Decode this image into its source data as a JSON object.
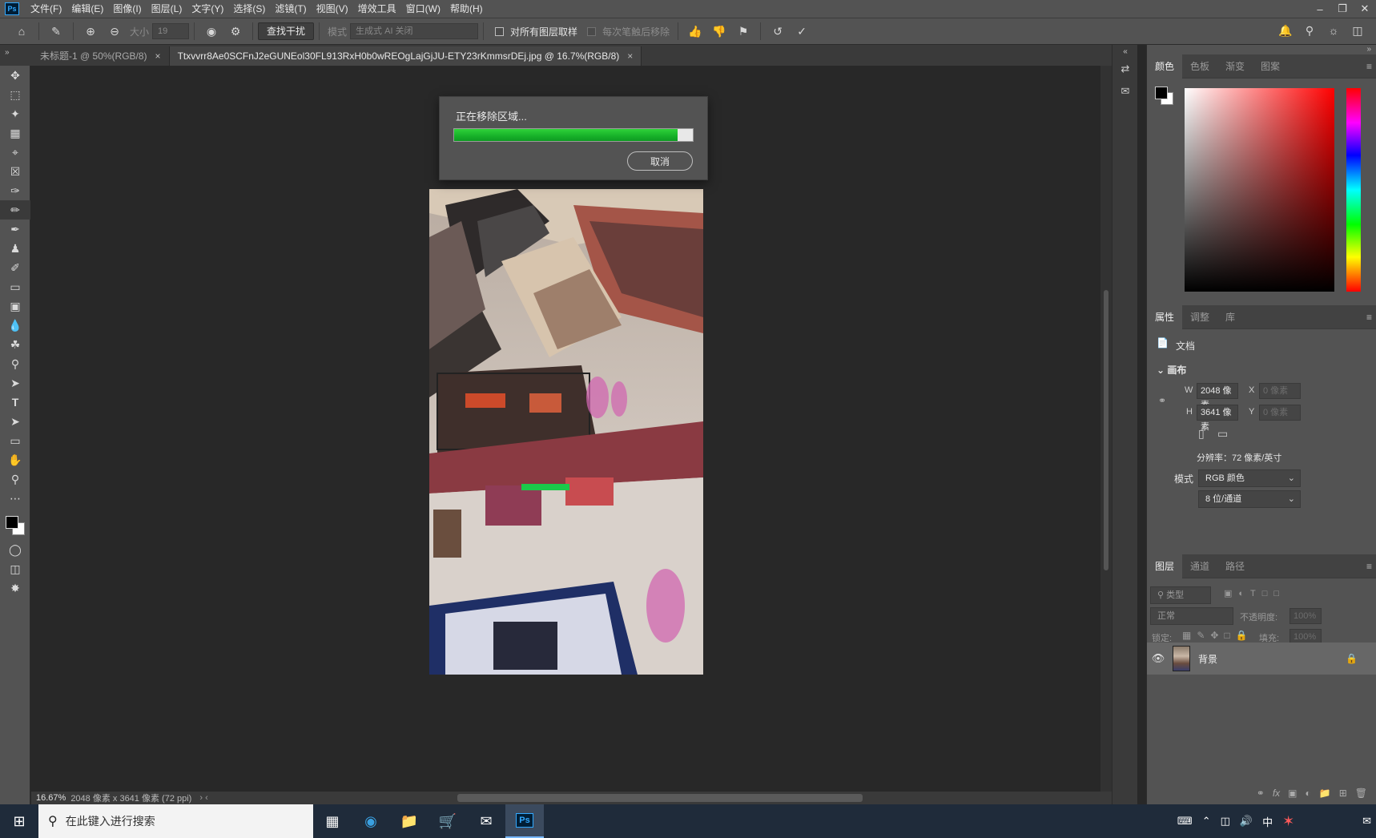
{
  "menubar": {
    "app_badge": "Ps",
    "items": [
      "文件(F)",
      "编辑(E)",
      "图像(I)",
      "图层(L)",
      "文字(Y)",
      "选择(S)",
      "滤镜(T)",
      "视图(V)",
      "增效工具",
      "窗口(W)",
      "帮助(H)"
    ]
  },
  "options": {
    "size_label": "大小",
    "size_value": "19",
    "find_distractions": "查找干扰",
    "mode_label": "模式",
    "mode_value": "生成式 AI 关闭",
    "sample_all_layers": "对所有图层取样",
    "remove_after_stroke": "每次笔触后移除"
  },
  "tabs": [
    {
      "label": "未标题-1 @ 50%(RGB/8)"
    },
    {
      "label": "Ttxvvrr8Ae0SCFnJ2eGUNEol30FL913RxH0b0wREOgLajGjJU-ETY23rKmmsrDEj.jpg @ 16.7%(RGB/8)"
    }
  ],
  "dialog": {
    "message": "正在移除区域...",
    "progress": 0.935,
    "cancel_label": "取消"
  },
  "status": {
    "zoom": "16.67%",
    "info": "2048 像素 x 3641 像素 (72 ppi)"
  },
  "color_panel": {
    "tabs": [
      "颜色",
      "色板",
      "渐变",
      "图案"
    ]
  },
  "properties_panel": {
    "tabs": [
      "属性",
      "调整",
      "库"
    ],
    "doc_label": "文档",
    "section": "画布",
    "w_label": "W",
    "w_value": "2048 像素",
    "h_label": "H",
    "h_value": "3641 像素",
    "x_label": "X",
    "x_placeholder": "0 像素",
    "y_label": "Y",
    "y_placeholder": "0 像素",
    "resolution": "分辨率：72 像素/英寸",
    "mode_label": "模式",
    "mode_value": "RGB 颜色",
    "depth_value": "8 位/通道"
  },
  "layers_panel": {
    "tabs": [
      "图层",
      "通道",
      "路径"
    ],
    "filter_label": "类型",
    "blend_mode": "正常",
    "opacity_label": "不透明度:",
    "opacity_value": "100%",
    "lock_label": "锁定:",
    "fill_label": "填充:",
    "fill_value": "100%",
    "layer_name": "背景"
  },
  "taskbar": {
    "search_placeholder": "在此键入进行搜索",
    "ime": "中"
  }
}
